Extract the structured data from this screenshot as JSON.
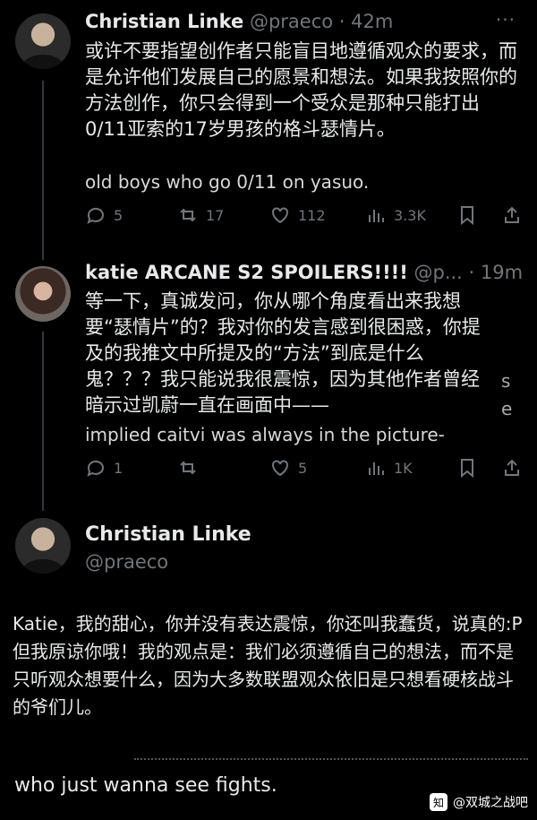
{
  "tweet1": {
    "name": "Christian Linke",
    "handle": "@praeco · 42m",
    "more": "···",
    "text": "或许不要指望创作者只能盲目地遵循观众的要求，而是允许他们发展自己的愿景和想法。如果我按照你的方法创作，你只会得到一个受众是那种只能打出0/11亚索的17岁男孩的格斗瑟情片。",
    "sub": "old boys who go 0/11 on yasuo.",
    "replies": "5",
    "reposts": "17",
    "likes": "112",
    "views": "3.3K"
  },
  "tweet2": {
    "name": "katie ARCANE S2 SPOILERS!!!!",
    "handle": "@p... · 19m",
    "text": "等一下，真诚发问，你从哪个角度看出来我想要“瑟情片”的？我对你的发言感到很困惑，你提及的我推文中所提及的“方法”到底是什么鬼？？？我只能说我很震惊，因为其他作者曾经暗示过凯蔚一直在画面中——",
    "sub": "implied caitvi was always in the picture-",
    "ghost1": "s",
    "ghost2": "e",
    "replies": "1",
    "likes": "5",
    "views": "1K"
  },
  "tweet3": {
    "name": "Christian Linke",
    "handle": "@praeco",
    "text": "Katie，我的甜心，你并没有表达震惊，你还叫我蠢货，说真的:P 但我原谅你哦！我的观点是：我们必须遵循自己的想法，而不是只听观众想要什么，因为大多数联盟观众依旧是只想看硬核战斗的爷们儿。",
    "bottom": "who just wanna see fights."
  },
  "watermark": {
    "logo": "知",
    "text": "@双城之战吧"
  }
}
